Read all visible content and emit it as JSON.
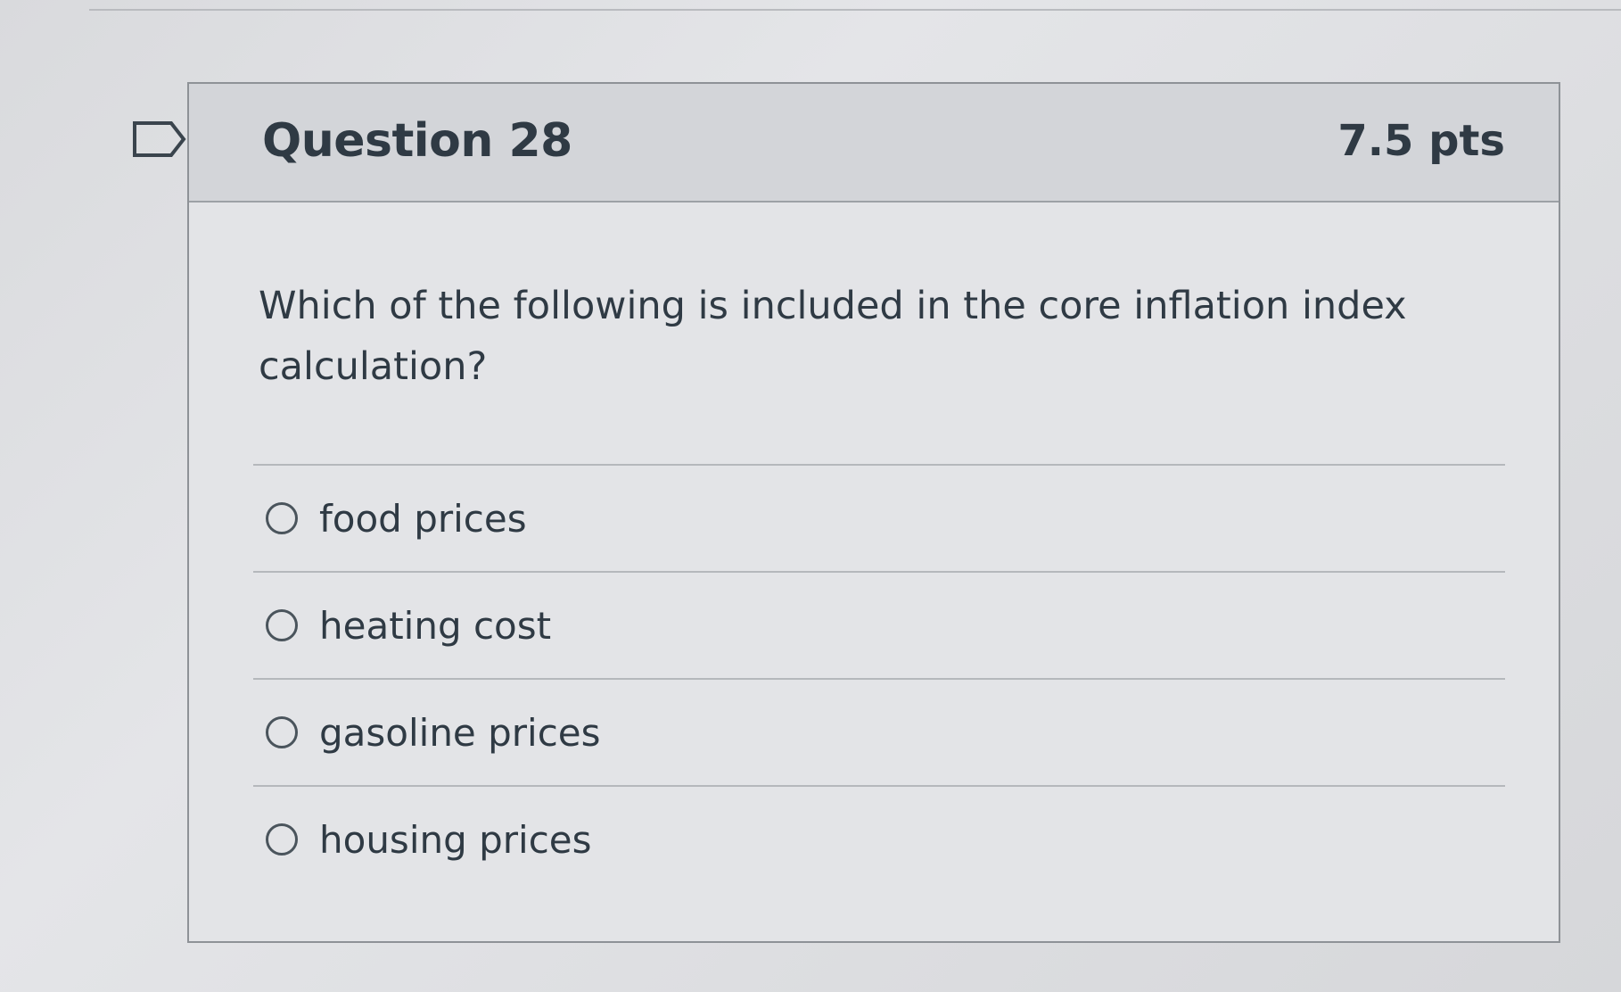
{
  "question": {
    "title": "Question 28",
    "points": "7.5 pts",
    "text": "Which of the following is included in the core inflation index calculation?",
    "bookmark_icon": "bookmark-flag-icon",
    "answers": [
      {
        "label": "food prices",
        "selected": false
      },
      {
        "label": "heating cost",
        "selected": false
      },
      {
        "label": "gasoline prices",
        "selected": false
      },
      {
        "label": "housing prices",
        "selected": false
      }
    ]
  }
}
